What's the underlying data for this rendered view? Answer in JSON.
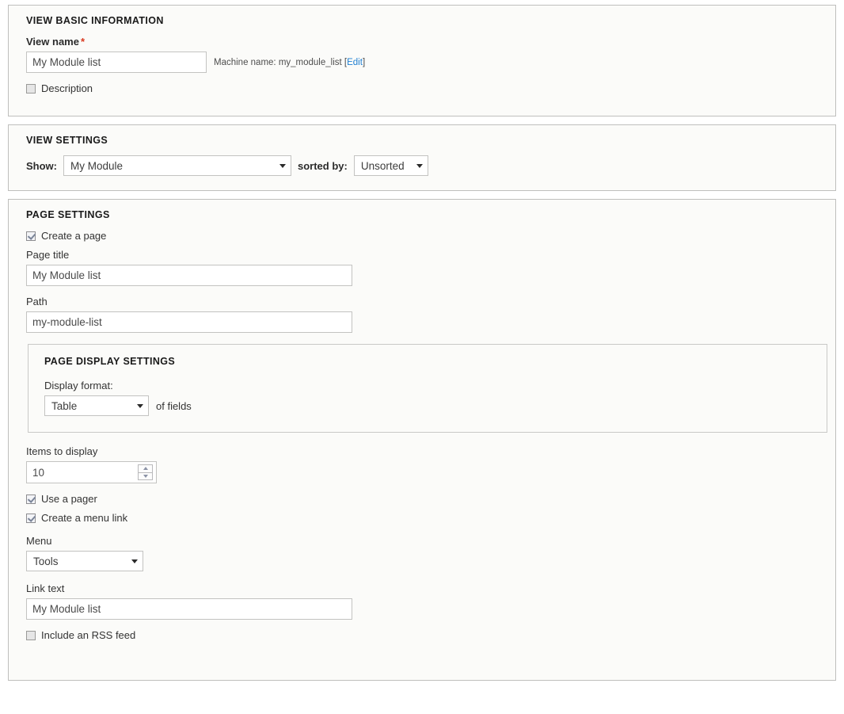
{
  "basic_info": {
    "title": "VIEW BASIC INFORMATION",
    "view_name_label": "View name",
    "required_mark": "*",
    "view_name_value": "My Module list",
    "machine_name_prefix": "Machine name: my_module_list [",
    "machine_name_edit": "Edit",
    "machine_name_suffix": "]",
    "description_label": "Description",
    "description_checked": false
  },
  "view_settings": {
    "title": "VIEW SETTINGS",
    "show_label": "Show:",
    "show_value": "My Module",
    "sorted_by_label": "sorted by:",
    "sorted_by_value": "Unsorted"
  },
  "page_settings": {
    "title": "PAGE SETTINGS",
    "create_page_label": "Create a page",
    "create_page_checked": true,
    "page_title_label": "Page title",
    "page_title_value": "My Module list",
    "path_label": "Path",
    "path_value": "my-module-list",
    "display_settings": {
      "title": "PAGE DISPLAY SETTINGS",
      "display_format_label": "Display format:",
      "display_format_value": "Table",
      "of_fields_label": "of fields"
    },
    "items_label": "Items to display",
    "items_value": "10",
    "use_pager_label": "Use a pager",
    "use_pager_checked": true,
    "create_menu_link_label": "Create a menu link",
    "create_menu_link_checked": true,
    "menu_label": "Menu",
    "menu_value": "Tools",
    "link_text_label": "Link text",
    "link_text_value": "My Module list",
    "rss_label": "Include an RSS feed",
    "rss_checked": false
  },
  "colors": {
    "required": "#d9391f",
    "link": "#1f7fd1",
    "panel_bg": "#fbfbf9",
    "panel_border": "#bfbfbd"
  }
}
